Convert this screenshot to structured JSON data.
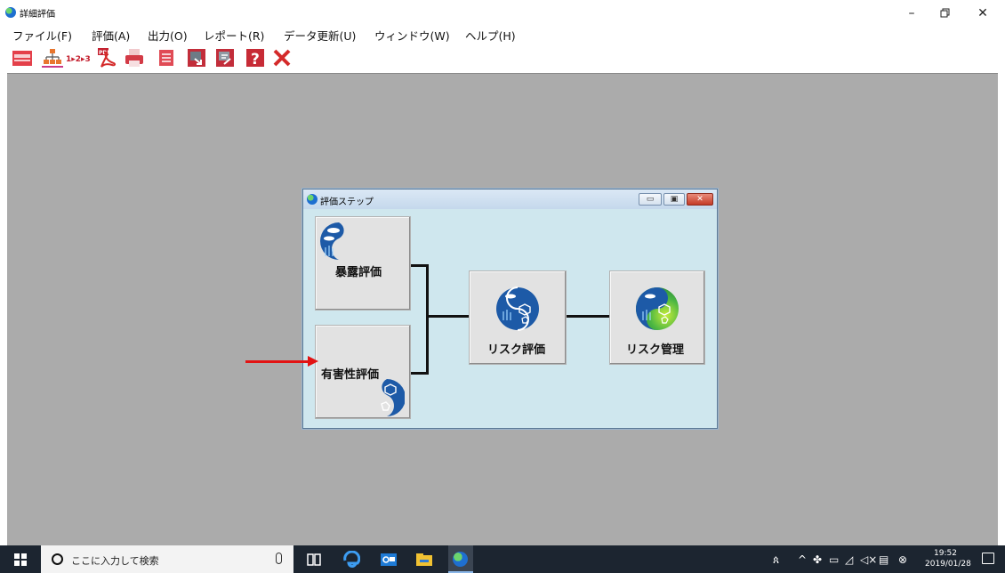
{
  "window": {
    "title": "詳細評価",
    "minimize_glyph": "–",
    "maximize_glyph": "🗗",
    "close_glyph": "✕"
  },
  "menu": [
    {
      "label": "ファイル(F)"
    },
    {
      "label": "評価(A)"
    },
    {
      "label": "出力(O)"
    },
    {
      "label": "レポート(R)"
    },
    {
      "label": "データ更新(U)"
    },
    {
      "label": "ウィンドウ(W)"
    },
    {
      "label": "ヘルプ(H)"
    }
  ],
  "toolbar": [
    {
      "icon": "folder-icon"
    },
    {
      "icon": "hierarchy-icon"
    },
    {
      "icon": "step-sequence-icon",
      "text": "1▸2▸3"
    },
    {
      "icon": "pdf-icon",
      "text": "PDF"
    },
    {
      "icon": "print-icon"
    },
    {
      "icon": "document-icon"
    },
    {
      "icon": "export-icon"
    },
    {
      "icon": "report-icon"
    },
    {
      "icon": "help-icon",
      "text": "?"
    },
    {
      "icon": "close-icon"
    }
  ],
  "child_window": {
    "title": "評価ステップ",
    "steps": {
      "exposure": {
        "label": "暴露評価",
        "icon": "fish-icon"
      },
      "hazard": {
        "label": "有害性評価",
        "icon": "molecule-icon"
      },
      "risk_assessment": {
        "label": "リスク評価",
        "icon": "risk-assessment-icon"
      },
      "risk_management": {
        "label": "リスク管理",
        "icon": "risk-management-icon"
      }
    }
  },
  "taskbar": {
    "search_placeholder": "ここに入力して検索",
    "clock_time": "19:52",
    "clock_date": "2019/01/28"
  },
  "colors": {
    "mdi_background": "#ababab",
    "child_background": "#cfe7ee",
    "arrow": "#e21313",
    "taskbar": "#1c2530"
  }
}
